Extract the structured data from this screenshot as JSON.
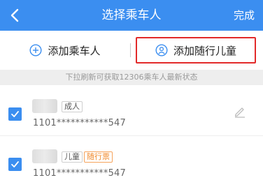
{
  "header": {
    "title": "选择乘车人",
    "done_label": "完成"
  },
  "actions": {
    "add_passenger_label": "添加乘车人",
    "add_child_label": "添加随行儿童"
  },
  "notice": "下拉刷新可获取12306乘车人最新状态",
  "passengers": [
    {
      "type_tag": "成人",
      "id_masked": "1101***********547",
      "checked": true
    },
    {
      "type_tag": "儿童",
      "extra_tag": "随行票",
      "id_masked": "1101***********547",
      "checked": true
    }
  ],
  "colors": {
    "header_bg": "#3b8ef0",
    "highlight_border": "#e22a2a",
    "checkbox": "#3b8ef0",
    "extra_tag": "#f08a2c"
  },
  "icons": [
    "back-arrow-icon",
    "plus-circle-icon",
    "child-user-icon",
    "checkmark-icon",
    "pencil-icon"
  ]
}
